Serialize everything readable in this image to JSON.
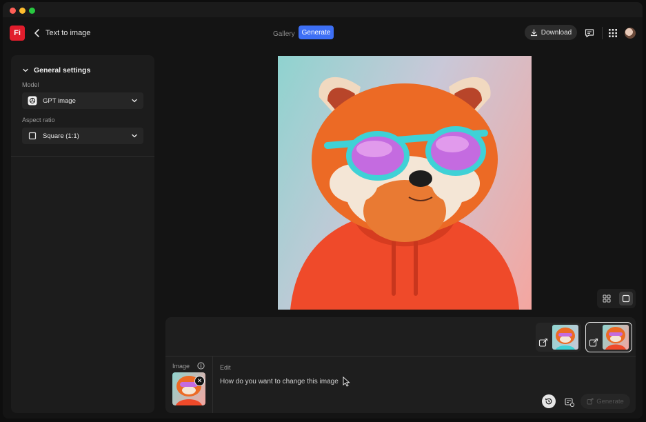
{
  "app": {
    "logo_text": "Fi",
    "page_title": "Text to image",
    "brand_color": "#e11d2c",
    "accent_color": "#3d6ff5"
  },
  "header": {
    "tabs": [
      {
        "label": "Gallery",
        "active": false
      },
      {
        "label": "Generate",
        "active": true
      }
    ],
    "download_label": "Download",
    "icons": [
      "back-icon",
      "download-icon",
      "feedback-icon",
      "apps-grid-icon",
      "avatar"
    ]
  },
  "sidebar": {
    "section_title": "General settings",
    "model": {
      "label": "Model",
      "value": "GPT image",
      "icon": "openai-icon"
    },
    "aspect_ratio": {
      "label": "Aspect ratio",
      "value": "Square (1:1)",
      "icon": "square-icon"
    }
  },
  "canvas": {
    "image_subject": "red panda in sunglasses and orange hoodie",
    "view_modes": [
      "grid-view-icon",
      "single-view-icon"
    ],
    "active_view": "single"
  },
  "thumbnails": [
    {
      "selected": false
    },
    {
      "selected": true
    }
  ],
  "editor": {
    "image_label": "Image",
    "edit_label": "Edit",
    "placeholder": "How do you want to change this image",
    "generate_label": "Generate"
  }
}
